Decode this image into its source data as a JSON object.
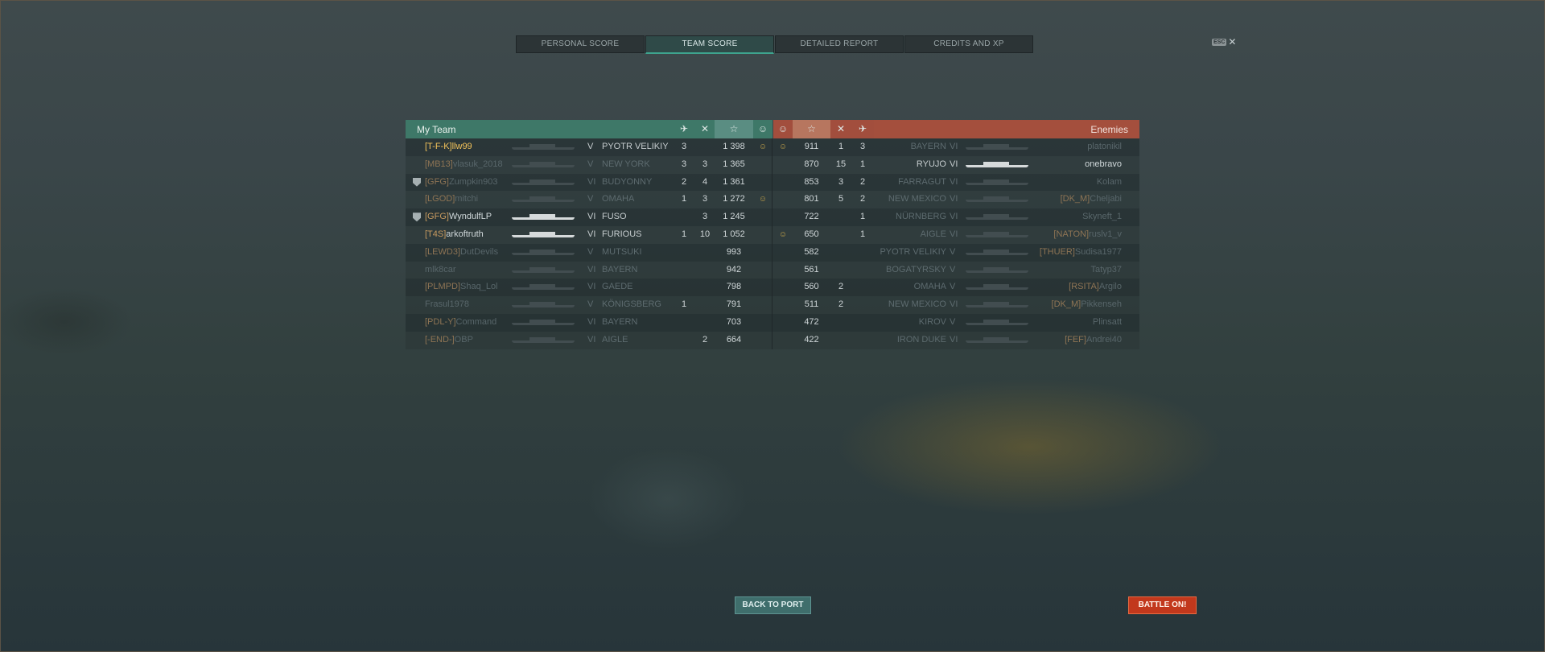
{
  "tabs": [
    "PERSONAL SCORE",
    "TEAM SCORE",
    "DETAILED REPORT",
    "CREDITS AND XP"
  ],
  "active_tab": 1,
  "esc": {
    "key": "ESC",
    "close": "✕"
  },
  "my_team": {
    "label": "My Team",
    "header_icons": [
      "plane-icon",
      "kills-icon",
      "star-icon",
      "smiley-icon"
    ],
    "players": [
      {
        "clan": "[T-F-K]",
        "name": "llw99",
        "tier": "V",
        "ship": "PYOTR VELIKIY",
        "planes": "3",
        "kills": "",
        "xp": "1 398",
        "smile": "☺",
        "me": true,
        "lit": false,
        "div": false
      },
      {
        "clan": "[MB13]",
        "name": "vlasuk_2018",
        "tier": "V",
        "ship": "NEW YORK",
        "planes": "3",
        "kills": "3",
        "xp": "1 365",
        "smile": "",
        "me": false,
        "lit": false,
        "div": false,
        "dead": true
      },
      {
        "clan": "[GFG]",
        "name": "Zumpkin903",
        "tier": "VI",
        "ship": "BUDYONNY",
        "planes": "2",
        "kills": "4",
        "xp": "1 361",
        "smile": "",
        "me": false,
        "lit": false,
        "div": true,
        "dead": true
      },
      {
        "clan": "[LGOD]",
        "name": "mitchi",
        "tier": "V",
        "ship": "OMAHA",
        "planes": "1",
        "kills": "3",
        "xp": "1 272",
        "smile": "☺",
        "me": false,
        "lit": false,
        "div": false,
        "dead": true
      },
      {
        "clan": "[GFG]",
        "name": "WyndulfLP",
        "tier": "VI",
        "ship": "FUSO",
        "planes": "",
        "kills": "3",
        "xp": "1 245",
        "smile": "",
        "me": false,
        "lit": true,
        "div": true
      },
      {
        "clan": "[T4S]",
        "name": "arkoftruth",
        "tier": "VI",
        "ship": "FURIOUS",
        "planes": "1",
        "kills": "10",
        "xp": "1 052",
        "smile": "",
        "me": false,
        "lit": true,
        "div": false
      },
      {
        "clan": "[LEWD3]",
        "name": "DutDevils",
        "tier": "V",
        "ship": "MUTSUKI",
        "planes": "",
        "kills": "",
        "xp": "993",
        "smile": "",
        "me": false,
        "lit": false,
        "div": false,
        "dead": true
      },
      {
        "clan": "",
        "name": "mlk8car",
        "tier": "VI",
        "ship": "BAYERN",
        "planes": "",
        "kills": "",
        "xp": "942",
        "smile": "",
        "me": false,
        "lit": false,
        "div": false,
        "dead": true
      },
      {
        "clan": "[PLMPD]",
        "name": "Shaq_Lol",
        "tier": "VI",
        "ship": "GAEDE",
        "planes": "",
        "kills": "",
        "xp": "798",
        "smile": "",
        "me": false,
        "lit": false,
        "div": false,
        "dead": true
      },
      {
        "clan": "",
        "name": "Frasul1978",
        "tier": "V",
        "ship": "KÖNIGSBERG",
        "planes": "1",
        "kills": "",
        "xp": "791",
        "smile": "",
        "me": false,
        "lit": false,
        "div": false,
        "dead": true
      },
      {
        "clan": "[PDL-Y]",
        "name": "Command",
        "tier": "VI",
        "ship": "BAYERN",
        "planes": "",
        "kills": "",
        "xp": "703",
        "smile": "",
        "me": false,
        "lit": false,
        "div": false,
        "dead": true
      },
      {
        "clan": "[-END-]",
        "name": "OBP",
        "tier": "VI",
        "ship": "AIGLE",
        "planes": "",
        "kills": "2",
        "xp": "664",
        "smile": "",
        "me": false,
        "lit": false,
        "div": false,
        "dead": true
      }
    ]
  },
  "enemies": {
    "label": "Enemies",
    "header_icons": [
      "smiley-icon",
      "star-icon",
      "kills-icon",
      "plane-icon"
    ],
    "players": [
      {
        "smile": "☺",
        "xp": "911",
        "kills": "1",
        "planes": "3",
        "ship": "BAYERN",
        "tier": "VI",
        "clan": "",
        "name": "platonikil",
        "lit": false,
        "dead": true
      },
      {
        "smile": "",
        "xp": "870",
        "kills": "15",
        "planes": "1",
        "ship": "RYUJO",
        "tier": "VI",
        "clan": "",
        "name": "onebravo",
        "lit": true,
        "dead": false
      },
      {
        "smile": "",
        "xp": "853",
        "kills": "3",
        "planes": "2",
        "ship": "FARRAGUT",
        "tier": "VI",
        "clan": "",
        "name": "Kolam",
        "lit": false,
        "dead": true
      },
      {
        "smile": "",
        "xp": "801",
        "kills": "5",
        "planes": "2",
        "ship": "NEW MEXICO",
        "tier": "VI",
        "clan": "[DK_M]",
        "name": "Cheljabi",
        "lit": false,
        "dead": true
      },
      {
        "smile": "",
        "xp": "722",
        "kills": "",
        "planes": "1",
        "ship": "NÜRNBERG",
        "tier": "VI",
        "clan": "",
        "name": "Skyneft_1",
        "lit": false,
        "dead": true
      },
      {
        "smile": "☺",
        "xp": "650",
        "kills": "",
        "planes": "1",
        "ship": "AIGLE",
        "tier": "VI",
        "clan": "[NATON]",
        "name": "ruslv1_v",
        "lit": false,
        "dead": true
      },
      {
        "smile": "",
        "xp": "582",
        "kills": "",
        "planes": "",
        "ship": "PYOTR VELIKIY",
        "tier": "V",
        "clan": "[THUER]",
        "name": "Sudisa1977",
        "lit": false,
        "dead": true
      },
      {
        "smile": "",
        "xp": "561",
        "kills": "",
        "planes": "",
        "ship": "BOGATYRSKY",
        "tier": "V",
        "clan": "",
        "name": "Tatyp37",
        "lit": false,
        "dead": true
      },
      {
        "smile": "",
        "xp": "560",
        "kills": "2",
        "planes": "",
        "ship": "OMAHA",
        "tier": "V",
        "clan": "[RSITA]",
        "name": "Argilo",
        "lit": false,
        "dead": true
      },
      {
        "smile": "",
        "xp": "511",
        "kills": "2",
        "planes": "",
        "ship": "NEW MEXICO",
        "tier": "VI",
        "clan": "[DK_M]",
        "name": "Pikkenseh",
        "lit": false,
        "dead": true
      },
      {
        "smile": "",
        "xp": "472",
        "kills": "",
        "planes": "",
        "ship": "KIROV",
        "tier": "V",
        "clan": "",
        "name": "Plinsatt",
        "lit": false,
        "dead": true
      },
      {
        "smile": "",
        "xp": "422",
        "kills": "",
        "planes": "",
        "ship": "IRON DUKE",
        "tier": "VI",
        "clan": "[FEF]",
        "name": "Andrei40",
        "lit": false,
        "dead": true
      }
    ]
  },
  "buttons": {
    "back": "BACK TO PORT",
    "battle": "BATTLE ON!"
  },
  "colors": {
    "my_team": "#3e7868",
    "enemies": "#a44f3d",
    "battle": "#c2381c",
    "highlight": "#f2c35a"
  }
}
